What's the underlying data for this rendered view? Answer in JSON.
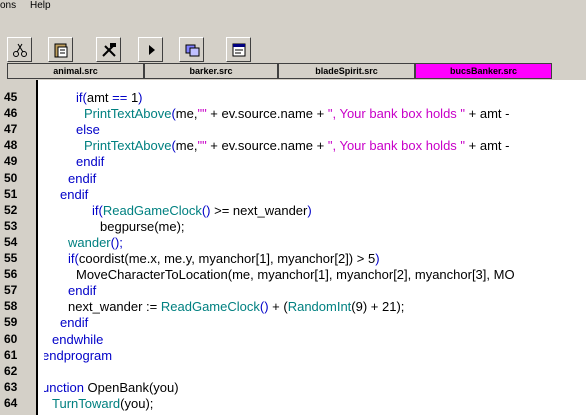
{
  "menu": {
    "items": [
      "ons",
      "Help"
    ]
  },
  "toolbar": {
    "buttons": [
      {
        "icon": "scissors-icon"
      },
      {
        "icon": "clipboard-icon"
      },
      {
        "icon": "tools-icon"
      },
      {
        "icon": "run-icon"
      },
      {
        "icon": "compile-icon"
      },
      {
        "icon": "properties-icon"
      }
    ]
  },
  "tabs": [
    {
      "label": "animal.src",
      "active": false
    },
    {
      "label": "barker.src",
      "active": false
    },
    {
      "label": "bladeSpirit.src",
      "active": false
    },
    {
      "label": "bucsBanker.src",
      "active": true
    }
  ],
  "editor": {
    "lines": [
      {
        "num": "45",
        "segs": [
          [
            "kw",
            "if("
          ],
          [
            "tx",
            "amt "
          ],
          [
            "kw",
            "=="
          ],
          [
            "tx",
            " 1"
          ],
          [
            "kw",
            ")"
          ]
        ]
      },
      {
        "num": "46",
        "segs": [
          [
            "fn",
            "PrintTextAbove"
          ],
          [
            "kw",
            "("
          ],
          [
            "tx",
            "me,"
          ],
          [
            "st",
            "\"\""
          ],
          [
            "tx",
            " + ev.source.name + "
          ],
          [
            "st",
            "\", Your bank box holds \""
          ],
          [
            "tx",
            " + amt -"
          ]
        ]
      },
      {
        "num": "47",
        "segs": [
          [
            "kw",
            "else"
          ]
        ]
      },
      {
        "num": "48",
        "segs": [
          [
            "fn",
            "PrintTextAbove"
          ],
          [
            "kw",
            "("
          ],
          [
            "tx",
            "me,"
          ],
          [
            "st",
            "\"\""
          ],
          [
            "tx",
            " + ev.source.name + "
          ],
          [
            "st",
            "\", Your bank box holds \""
          ],
          [
            "tx",
            " + amt -"
          ]
        ]
      },
      {
        "num": "49",
        "segs": [
          [
            "kw",
            "endif"
          ]
        ]
      },
      {
        "num": "50",
        "segs": [
          [
            "kw",
            "endif"
          ]
        ]
      },
      {
        "num": "51",
        "segs": [
          [
            "kw",
            "endif"
          ]
        ]
      },
      {
        "num": "52",
        "segs": [
          [
            "kw",
            "if("
          ],
          [
            "fn",
            "ReadGameClock"
          ],
          [
            "kw",
            "()"
          ],
          [
            "tx",
            " >= next_wander"
          ],
          [
            "kw",
            ")"
          ]
        ]
      },
      {
        "num": "53",
        "segs": [
          [
            "tx",
            "begpurse(me);"
          ]
        ]
      },
      {
        "num": "54",
        "segs": [
          [
            "fn",
            "wander"
          ],
          [
            "kw",
            "();"
          ]
        ]
      },
      {
        "num": "55",
        "segs": [
          [
            "kw",
            "if("
          ],
          [
            "tx",
            "coordist(me.x, me.y, myanchor[1], myanchor[2]) > 5"
          ],
          [
            "kw",
            ")"
          ]
        ]
      },
      {
        "num": "56",
        "segs": [
          [
            "tx",
            "MoveCharacterToLocation(me, myanchor[1], myanchor[2], myanchor[3], MO"
          ]
        ]
      },
      {
        "num": "57",
        "segs": [
          [
            "kw",
            "endif"
          ]
        ]
      },
      {
        "num": "58",
        "segs": [
          [
            "tx",
            "next_wander := "
          ],
          [
            "fn",
            "ReadGameClock"
          ],
          [
            "kw",
            "()"
          ],
          [
            "tx",
            " + ("
          ],
          [
            "fn",
            "RandomInt"
          ],
          [
            "tx",
            "(9) + 21);"
          ]
        ]
      },
      {
        "num": "59",
        "segs": [
          [
            "kw",
            "endif"
          ]
        ]
      },
      {
        "num": "60",
        "segs": [
          [
            "kw",
            "endwhile"
          ]
        ]
      },
      {
        "num": "61",
        "segs": [
          [
            "kw",
            "endprogram"
          ]
        ]
      },
      {
        "num": "62",
        "segs": []
      },
      {
        "num": "63",
        "segs": [
          [
            "kw",
            "unction"
          ],
          [
            "tx",
            " OpenBank(you)"
          ]
        ]
      },
      {
        "num": "64",
        "segs": [
          [
            "fn",
            "TurnToward"
          ],
          [
            "tx",
            "(you);"
          ]
        ]
      }
    ]
  }
}
